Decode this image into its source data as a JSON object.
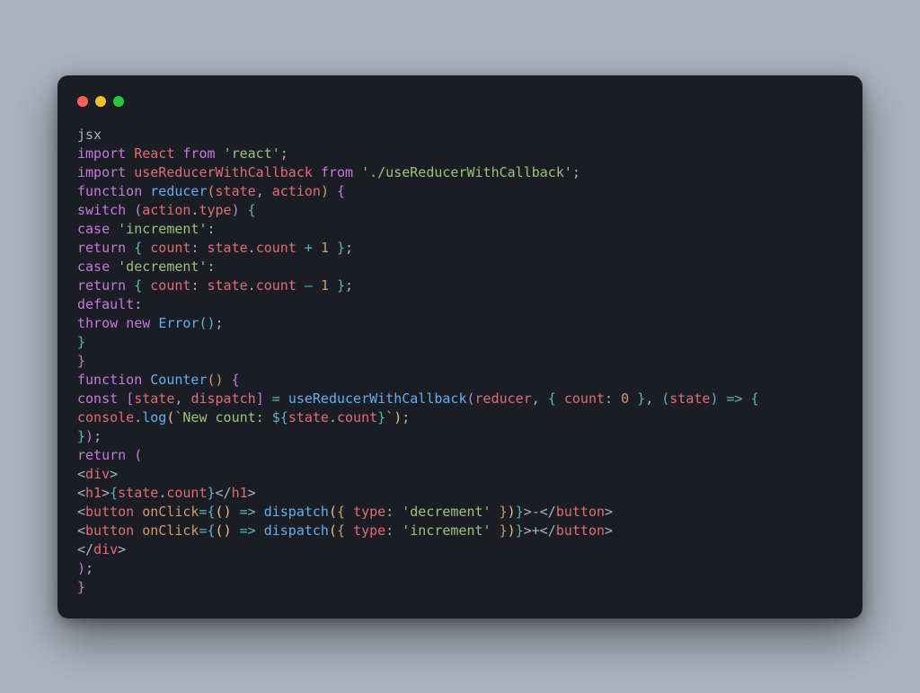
{
  "window": {
    "traffic_lights": [
      "close",
      "minimize",
      "zoom"
    ],
    "colors": {
      "background": "#1b1d25",
      "page_background": "#aab3bf",
      "close": "#ff5f56",
      "minimize": "#ffbd2e",
      "zoom": "#27c93f"
    }
  },
  "code": {
    "language_tag": "jsx",
    "lines": [
      [
        [
          "plain",
          "jsx"
        ]
      ],
      [
        [
          "kw",
          "import"
        ],
        [
          "plain",
          " "
        ],
        [
          "var",
          "React"
        ],
        [
          "plain",
          " "
        ],
        [
          "kw",
          "from"
        ],
        [
          "plain",
          " "
        ],
        [
          "str",
          "'react'"
        ],
        [
          "plain",
          ";"
        ]
      ],
      [
        [
          "kw",
          "import"
        ],
        [
          "plain",
          " "
        ],
        [
          "var",
          "useReducerWithCallback"
        ],
        [
          "plain",
          " "
        ],
        [
          "kw",
          "from"
        ],
        [
          "plain",
          " "
        ],
        [
          "str",
          "'./useReducerWithCallback'"
        ],
        [
          "plain",
          ";"
        ]
      ],
      [
        [
          "kw",
          "function"
        ],
        [
          "plain",
          " "
        ],
        [
          "id",
          "reducer"
        ],
        [
          "br",
          "("
        ],
        [
          "var",
          "state"
        ],
        [
          "plain",
          ", "
        ],
        [
          "var",
          "action"
        ],
        [
          "br",
          ")"
        ],
        [
          "plain",
          " "
        ],
        [
          "brp",
          "{"
        ]
      ],
      [
        [
          "kw",
          "switch"
        ],
        [
          "plain",
          " "
        ],
        [
          "brp",
          "("
        ],
        [
          "var",
          "action"
        ],
        [
          "plain",
          "."
        ],
        [
          "var",
          "type"
        ],
        [
          "brp",
          ")"
        ],
        [
          "plain",
          " "
        ],
        [
          "brb",
          "{"
        ]
      ],
      [
        [
          "kw",
          "case"
        ],
        [
          "plain",
          " "
        ],
        [
          "str",
          "'increment'"
        ],
        [
          "plain",
          ":"
        ]
      ],
      [
        [
          "kw",
          "return"
        ],
        [
          "plain",
          " "
        ],
        [
          "brb",
          "{"
        ],
        [
          "plain",
          " "
        ],
        [
          "var",
          "count"
        ],
        [
          "plain",
          ": "
        ],
        [
          "var",
          "state"
        ],
        [
          "plain",
          "."
        ],
        [
          "var",
          "count"
        ],
        [
          "plain",
          " "
        ],
        [
          "op",
          "+"
        ],
        [
          "plain",
          " "
        ],
        [
          "num",
          "1"
        ],
        [
          "plain",
          " "
        ],
        [
          "brb",
          "}"
        ],
        [
          "plain",
          ";"
        ]
      ],
      [
        [
          "kw",
          "case"
        ],
        [
          "plain",
          " "
        ],
        [
          "str",
          "'decrement'"
        ],
        [
          "plain",
          ":"
        ]
      ],
      [
        [
          "kw",
          "return"
        ],
        [
          "plain",
          " "
        ],
        [
          "brb",
          "{"
        ],
        [
          "plain",
          " "
        ],
        [
          "var",
          "count"
        ],
        [
          "plain",
          ": "
        ],
        [
          "var",
          "state"
        ],
        [
          "plain",
          "."
        ],
        [
          "var",
          "count"
        ],
        [
          "plain",
          " "
        ],
        [
          "op",
          "—"
        ],
        [
          "plain",
          " "
        ],
        [
          "num",
          "1"
        ],
        [
          "plain",
          " "
        ],
        [
          "brb",
          "}"
        ],
        [
          "plain",
          ";"
        ]
      ],
      [
        [
          "kw",
          "default"
        ],
        [
          "plain",
          ":"
        ]
      ],
      [
        [
          "kw",
          "throw"
        ],
        [
          "plain",
          " "
        ],
        [
          "kw",
          "new"
        ],
        [
          "plain",
          " "
        ],
        [
          "id",
          "Error"
        ],
        [
          "brb",
          "("
        ],
        [
          "brb",
          ")"
        ],
        [
          "plain",
          ";"
        ]
      ],
      [
        [
          "brb",
          "}"
        ]
      ],
      [
        [
          "brp",
          "}"
        ]
      ],
      [
        [
          "kw",
          "function"
        ],
        [
          "plain",
          " "
        ],
        [
          "id",
          "Counter"
        ],
        [
          "br",
          "("
        ],
        [
          "br",
          ")"
        ],
        [
          "plain",
          " "
        ],
        [
          "brp",
          "{"
        ]
      ],
      [
        [
          "kw",
          "const"
        ],
        [
          "plain",
          " "
        ],
        [
          "brp",
          "["
        ],
        [
          "var",
          "state"
        ],
        [
          "plain",
          ", "
        ],
        [
          "var",
          "dispatch"
        ],
        [
          "brp",
          "]"
        ],
        [
          "plain",
          " "
        ],
        [
          "op",
          "="
        ],
        [
          "plain",
          " "
        ],
        [
          "id",
          "useReducerWithCallback"
        ],
        [
          "brp",
          "("
        ],
        [
          "var",
          "reducer"
        ],
        [
          "plain",
          ", "
        ],
        [
          "brb",
          "{"
        ],
        [
          "plain",
          " "
        ],
        [
          "var",
          "count"
        ],
        [
          "plain",
          ": "
        ],
        [
          "num",
          "0"
        ],
        [
          "plain",
          " "
        ],
        [
          "brb",
          "}"
        ],
        [
          "plain",
          ", "
        ],
        [
          "brb",
          "("
        ],
        [
          "var",
          "state"
        ],
        [
          "brb",
          ")"
        ],
        [
          "plain",
          " "
        ],
        [
          "op",
          "=>"
        ],
        [
          "plain",
          " "
        ],
        [
          "brb",
          "{"
        ]
      ],
      [
        [
          "var",
          "console"
        ],
        [
          "plain",
          "."
        ],
        [
          "id",
          "log"
        ],
        [
          "bry",
          "("
        ],
        [
          "str",
          "`New count: "
        ],
        [
          "op",
          "${"
        ],
        [
          "var",
          "state"
        ],
        [
          "plain",
          "."
        ],
        [
          "var",
          "count"
        ],
        [
          "op",
          "}"
        ],
        [
          "str",
          "`"
        ],
        [
          "bry",
          ")"
        ],
        [
          "plain",
          ";"
        ]
      ],
      [
        [
          "brb",
          "}"
        ],
        [
          "brp",
          ")"
        ],
        [
          "plain",
          ";"
        ]
      ],
      [
        [
          "kw",
          "return"
        ],
        [
          "plain",
          " "
        ],
        [
          "brp",
          "("
        ]
      ],
      [
        [
          "plain",
          "<"
        ],
        [
          "tag",
          "div"
        ],
        [
          "plain",
          ">"
        ]
      ],
      [
        [
          "plain",
          "<"
        ],
        [
          "tag",
          "h1"
        ],
        [
          "plain",
          ">"
        ],
        [
          "brb",
          "{"
        ],
        [
          "var",
          "state"
        ],
        [
          "plain",
          "."
        ],
        [
          "var",
          "count"
        ],
        [
          "brb",
          "}"
        ],
        [
          "plain",
          "</"
        ],
        [
          "tag",
          "h1"
        ],
        [
          "plain",
          ">"
        ]
      ],
      [
        [
          "plain",
          "<"
        ],
        [
          "tag",
          "button"
        ],
        [
          "plain",
          " "
        ],
        [
          "attr",
          "onClick"
        ],
        [
          "op",
          "="
        ],
        [
          "brb",
          "{"
        ],
        [
          "bry",
          "("
        ],
        [
          "bry",
          ")"
        ],
        [
          "plain",
          " "
        ],
        [
          "op",
          "=>"
        ],
        [
          "plain",
          " "
        ],
        [
          "id",
          "dispatch"
        ],
        [
          "bry",
          "("
        ],
        [
          "br",
          "{"
        ],
        [
          "plain",
          " "
        ],
        [
          "var",
          "type"
        ],
        [
          "plain",
          ": "
        ],
        [
          "str",
          "'decrement'"
        ],
        [
          "plain",
          " "
        ],
        [
          "br",
          "}"
        ],
        [
          "bry",
          ")"
        ],
        [
          "brb",
          "}"
        ],
        [
          "plain",
          ">-</"
        ],
        [
          "tag",
          "button"
        ],
        [
          "plain",
          ">"
        ]
      ],
      [
        [
          "plain",
          "<"
        ],
        [
          "tag",
          "button"
        ],
        [
          "plain",
          " "
        ],
        [
          "attr",
          "onClick"
        ],
        [
          "op",
          "="
        ],
        [
          "brb",
          "{"
        ],
        [
          "bry",
          "("
        ],
        [
          "bry",
          ")"
        ],
        [
          "plain",
          " "
        ],
        [
          "op",
          "=>"
        ],
        [
          "plain",
          " "
        ],
        [
          "id",
          "dispatch"
        ],
        [
          "bry",
          "("
        ],
        [
          "br",
          "{"
        ],
        [
          "plain",
          " "
        ],
        [
          "var",
          "type"
        ],
        [
          "plain",
          ": "
        ],
        [
          "str",
          "'increment'"
        ],
        [
          "plain",
          " "
        ],
        [
          "br",
          "}"
        ],
        [
          "bry",
          ")"
        ],
        [
          "brb",
          "}"
        ],
        [
          "plain",
          ">+</"
        ],
        [
          "tag",
          "button"
        ],
        [
          "plain",
          ">"
        ]
      ],
      [
        [
          "plain",
          "</"
        ],
        [
          "tag",
          "div"
        ],
        [
          "plain",
          ">"
        ]
      ],
      [
        [
          "brp",
          ")"
        ],
        [
          "plain",
          ";"
        ]
      ],
      [
        [
          "brp",
          "}"
        ]
      ]
    ]
  }
}
